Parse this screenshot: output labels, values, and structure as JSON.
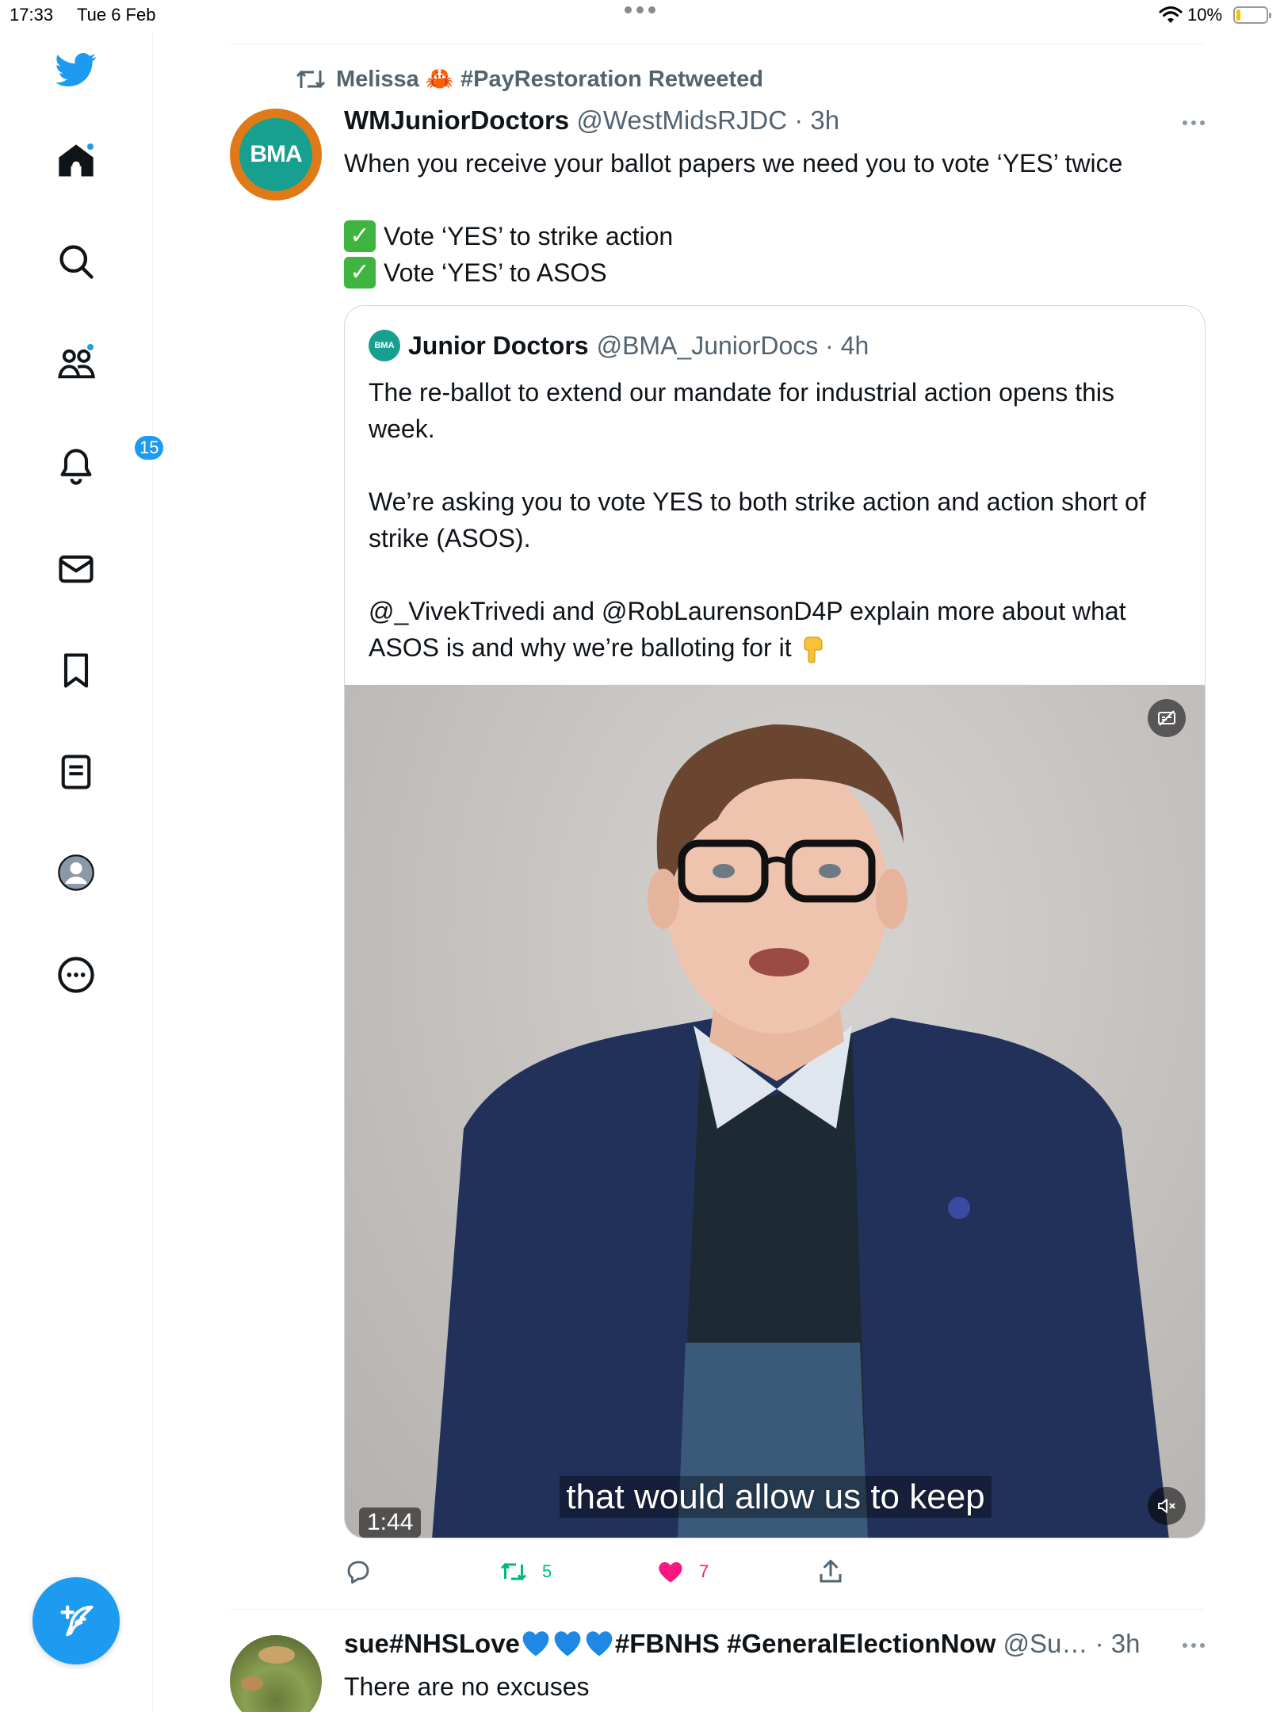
{
  "status_bar": {
    "time": "17:33",
    "date": "Tue 6 Feb",
    "battery": "10%"
  },
  "sidebar": {
    "notifications_badge": "15"
  },
  "tweet": {
    "retweeted_by": "Melissa 🦀 #PayRestoration Retweeted",
    "name": "WMJuniorDoctors",
    "handle_time": "@WestMidsRJDC · 3h",
    "avatar_text": "BMA",
    "text": "When you receive your ballot papers we need you to vote ‘YES’ twice",
    "checks": [
      "Vote ‘YES’ to strike action",
      "Vote ‘YES’ to ASOS"
    ],
    "quote": {
      "avatar_text": "BMA",
      "name": "Junior Doctors",
      "handle_time": "@BMA_JuniorDocs · 4h",
      "paragraphs": [
        "The re-ballot to extend our mandate for industrial action opens this week.",
        "We’re asking you to vote YES to both strike action and action short of strike (ASOS).",
        "@_VivekTrivedi and @RobLaurensonD4P explain more about what ASOS is and why we’re balloting for it"
      ],
      "video": {
        "caption": "that would allow us to keep",
        "duration": "1:44"
      }
    },
    "actions": {
      "retweets": "5",
      "likes": "7"
    }
  },
  "next_tweet": {
    "name_prefix": "sue#NHSLove",
    "name_suffix": "#FBNHS #GeneralElectionNow",
    "handle_time": "@Su… · 3h",
    "text": "There are no excuses"
  },
  "colors": {
    "accent": "#1d9bf0",
    "retweet_green": "#00ba7c",
    "like_pink": "#f91880",
    "muted_text": "#536471"
  }
}
